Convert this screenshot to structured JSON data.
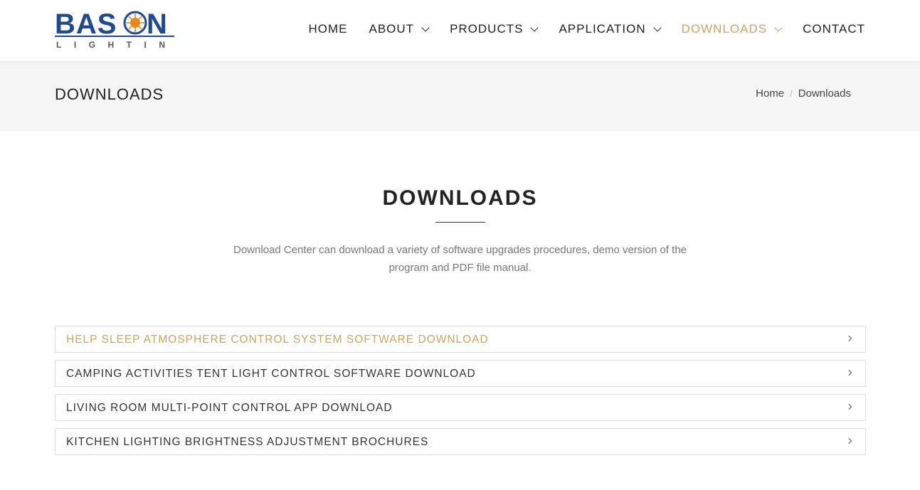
{
  "brand": {
    "name": "BASON",
    "tagline": "LIGHTING",
    "primary_color": "#1f4a8e",
    "accent_color": "#e8861f"
  },
  "theme": {
    "accent": "#c9a463",
    "banner_bg": "#f5f5f5"
  },
  "nav": {
    "items": [
      {
        "label": "HOME",
        "has_dropdown": false,
        "active": false
      },
      {
        "label": "ABOUT",
        "has_dropdown": true,
        "active": false
      },
      {
        "label": "PRODUCTS",
        "has_dropdown": true,
        "active": false
      },
      {
        "label": "APPLICATION",
        "has_dropdown": true,
        "active": false
      },
      {
        "label": "DOWNLOADS",
        "has_dropdown": true,
        "active": true
      },
      {
        "label": "CONTACT",
        "has_dropdown": false,
        "active": false
      }
    ]
  },
  "banner": {
    "title": "DOWNLOADS",
    "breadcrumb": [
      "Home",
      "Downloads"
    ]
  },
  "main": {
    "title": "DOWNLOADS",
    "intro": "Download Center can download a variety of software upgrades procedures, demo version of the program and PDF file manual.",
    "downloads": [
      {
        "label": "HELP SLEEP ATMOSPHERE CONTROL SYSTEM SOFTWARE DOWNLOAD",
        "highlight": true
      },
      {
        "label": "CAMPING ACTIVITIES TENT LIGHT CONTROL SOFTWARE DOWNLOAD",
        "highlight": false
      },
      {
        "label": "LIVING ROOM MULTI-POINT CONTROL APP DOWNLOAD",
        "highlight": false
      },
      {
        "label": "KITCHEN LIGHTING BRIGHTNESS ADJUSTMENT BROCHURES",
        "highlight": false
      }
    ],
    "item_icon": "chevron-right-icon"
  }
}
